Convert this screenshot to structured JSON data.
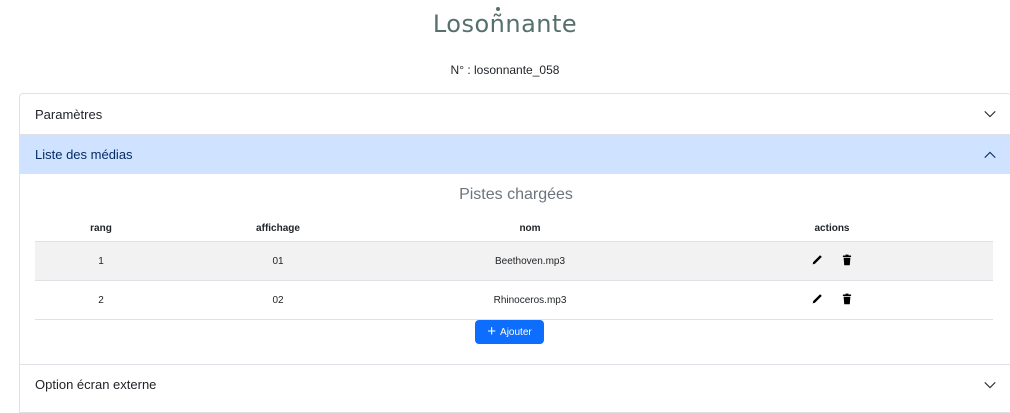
{
  "header": {
    "logo_prefix": "Loso",
    "logo_mark": "ñ",
    "logo_suffix": "nante",
    "serial": "N° : losonnante_058"
  },
  "accordion": {
    "sections": [
      {
        "label": "Paramètres",
        "state": "collapsed",
        "icon": "chevron-down-icon"
      },
      {
        "label": "Liste des médias",
        "state": "expanded",
        "icon": "chevron-up-icon"
      },
      {
        "label": "Option écran externe",
        "state": "collapsed",
        "icon": "chevron-down-icon"
      }
    ]
  },
  "media_list": {
    "title": "Pistes chargées",
    "columns": [
      "rang",
      "affichage",
      "nom",
      "actions"
    ],
    "rows": [
      {
        "rang": "1",
        "affichage": "01",
        "nom": "Beethoven.mp3"
      },
      {
        "rang": "2",
        "affichage": "02",
        "nom": "Rhinoceros.mp3"
      }
    ],
    "add_button": "Ajouter"
  },
  "colors": {
    "accent": "#0d6efd",
    "open_header_bg": "#cfe2ff",
    "logo": "#55706d",
    "row_stripe": "#f2f2f2"
  }
}
